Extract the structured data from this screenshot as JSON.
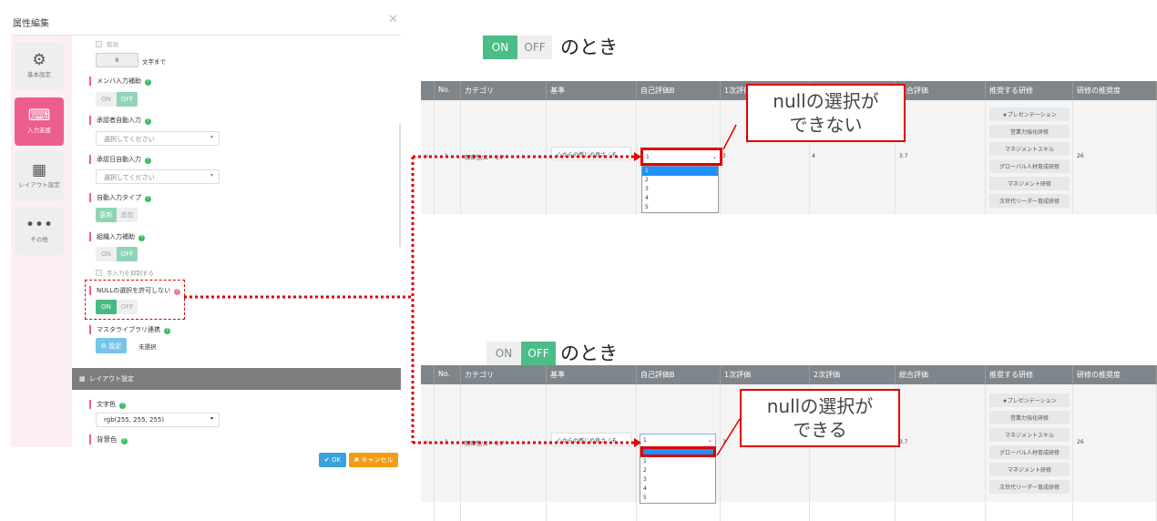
{
  "dialog": {
    "title": "属性編集",
    "close_icon": "close-icon",
    "sidebar": [
      {
        "label": "基本設定",
        "icon": "gear-icon"
      },
      {
        "label": "入力支援",
        "icon": "keyboard-icon"
      },
      {
        "label": "レイアウト設定",
        "icon": "layout-icon"
      },
      {
        "label": "その他",
        "icon": "more-icon"
      }
    ],
    "fields": {
      "enabled_checkbox": "有効",
      "max_chars_value": "0",
      "max_chars_suffix": "文字まで",
      "member_assist": {
        "label": "メンバ入力補助",
        "on": "ON",
        "off": "OFF",
        "state": "OFF"
      },
      "approver_auto": {
        "label": "承認者自動入力",
        "placeholder": "選択してください"
      },
      "approval_date_auto": {
        "label": "承認日自動入力",
        "placeholder": "選択してください"
      },
      "auto_type": {
        "label": "自動入力タイプ",
        "update": "更新",
        "add": "追加",
        "state": "更新"
      },
      "org_assist": {
        "label": "組織入力補助",
        "on": "ON",
        "off": "OFF",
        "state": "OFF"
      },
      "suppress_manual": "手入力を抑制する",
      "null_disallow": {
        "label": "NULLの選択を許可しない",
        "on": "ON",
        "off": "OFF",
        "state": "ON"
      },
      "master_library": {
        "label": "マスタライブラリ連携",
        "button": "設定",
        "value": "未選択"
      },
      "layout_section": "レイアウト設定",
      "text_color": {
        "label": "文字色",
        "value": "rgb(255, 255, 255)"
      },
      "bg_color": {
        "label": "背景色"
      }
    },
    "ok": "OK",
    "cancel": "キャンセル",
    "colors": {
      "accent": "#ec5f8d",
      "toggle_on": "#49b883",
      "ok": "#3aa3dc",
      "cancel": "#f39c12"
    }
  },
  "annotations": {
    "top": {
      "on": "ON",
      "off": "OFF",
      "state": "ON",
      "suffix": "のとき",
      "callout_line1": "nullの選択が",
      "callout_line2": "できない"
    },
    "bottom": {
      "on": "ON",
      "off": "OFF",
      "state": "OFF",
      "suffix": "のとき",
      "callout_line1": "nullの選択が",
      "callout_line2": "できる"
    }
  },
  "table": {
    "headers": [
      "No.",
      "カテゴリ",
      "基準",
      "自己評価B",
      "1次評価",
      "2次評価",
      "総合評価",
      "推奨する研修",
      "研修の推奨度"
    ],
    "row": {
      "no": "1",
      "category": "親密性/ユーモア",
      "criteria": "心からの感じの良さ／そ",
      "self_b": "1",
      "first": "3",
      "second": "4",
      "total": "3.7",
      "trainings": [
        "★プレゼンテーション",
        "営業力強化研修",
        "マネジメントスキル",
        "グローバル人材育成研修",
        "マネジメント研修",
        "次世代リーダー育成研修"
      ],
      "score": "26"
    },
    "options_top": [
      "1",
      "2",
      "3",
      "4",
      "5"
    ],
    "options_bottom": [
      "",
      "1",
      "2",
      "3",
      "4",
      "5"
    ]
  }
}
